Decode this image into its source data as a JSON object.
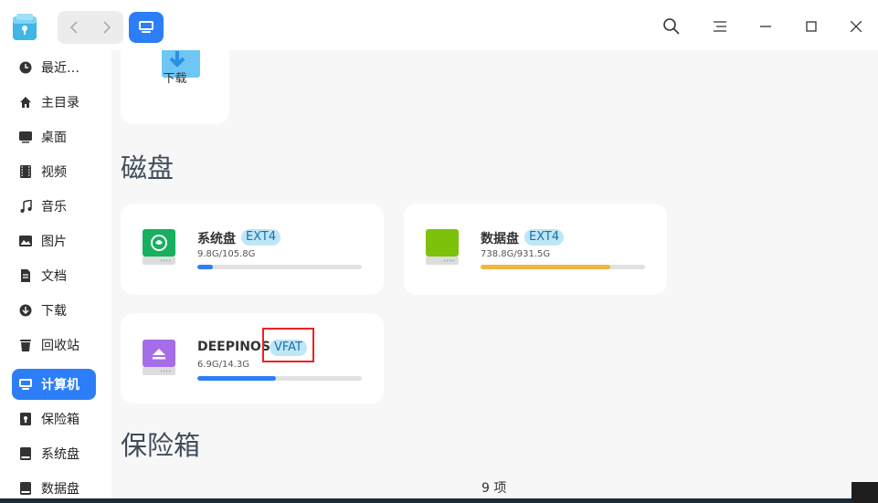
{
  "window": {
    "toolbar": {
      "search_icon": "search-icon",
      "menu_icon": "menu-icon"
    }
  },
  "sidebar": {
    "items": [
      {
        "label": "最近…",
        "icon": "clock-icon"
      },
      {
        "label": "主目录",
        "icon": "home-icon"
      },
      {
        "label": "桌面",
        "icon": "desktop-icon"
      },
      {
        "label": "视频",
        "icon": "video-icon"
      },
      {
        "label": "音乐",
        "icon": "music-icon"
      },
      {
        "label": "图片",
        "icon": "picture-icon"
      },
      {
        "label": "文档",
        "icon": "document-icon"
      },
      {
        "label": "下载",
        "icon": "download-icon"
      },
      {
        "label": "回收站",
        "icon": "trash-icon"
      },
      {
        "label": "计算机",
        "icon": "computer-icon",
        "active": true
      },
      {
        "label": "保险箱",
        "icon": "vault-icon"
      },
      {
        "label": "系统盘",
        "icon": "disk-icon"
      },
      {
        "label": "数据盘",
        "icon": "disk-icon"
      }
    ]
  },
  "main": {
    "folder_card": {
      "label": "下载"
    },
    "disks_section": {
      "title": "磁盘"
    },
    "disks": [
      {
        "name": "系统盘",
        "fs": "EXT4",
        "size": "9.8G/105.8G",
        "usage": 0.093,
        "bar_color": "#2c7ef8"
      },
      {
        "name": "数据盘",
        "fs": "EXT4",
        "size": "738.8G/931.5G",
        "usage": 0.79,
        "bar_color": "#f1b540"
      },
      {
        "name": "DEEPINOS",
        "fs": "VFAT",
        "size": "6.9G/14.3G",
        "usage": 0.48,
        "bar_color": "#2c7ef8"
      }
    ],
    "vault_section": {
      "title": "保险箱"
    },
    "status": "9 项"
  },
  "colors": {
    "accent": "#2c7ef8",
    "warning_bar": "#f1b540",
    "highlight": "#e22222"
  }
}
